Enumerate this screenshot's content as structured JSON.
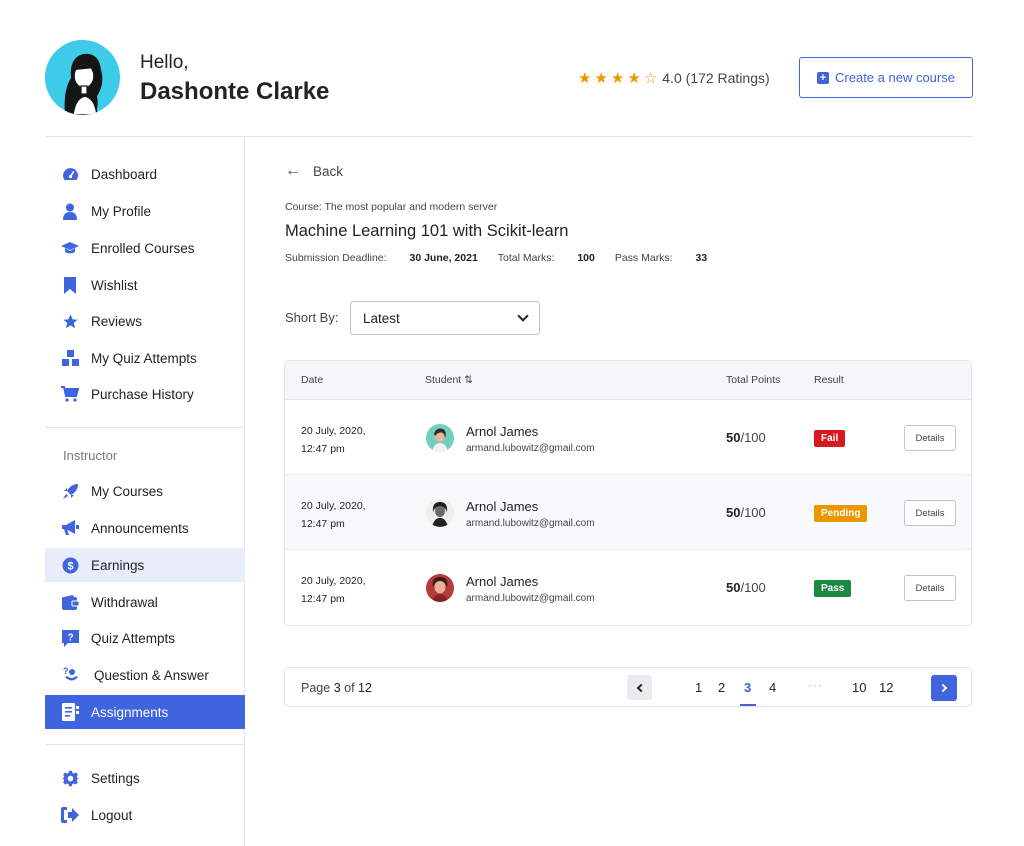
{
  "header": {
    "greeting": "Hello,",
    "user_name": "Dashonte Clarke",
    "rating_value": "4.0",
    "rating_text": "4.0 (172 Ratings)",
    "stars_filled": 4,
    "stars_total": 5,
    "create_button": "Create a new course"
  },
  "sidebar": {
    "items": [
      {
        "label": "Dashboard",
        "icon": "dashboard-icon"
      },
      {
        "label": "My Profile",
        "icon": "user-icon"
      },
      {
        "label": "Enrolled Courses",
        "icon": "graduation-cap-icon"
      },
      {
        "label": "Wishlist",
        "icon": "bookmark-icon"
      },
      {
        "label": "Reviews",
        "icon": "star-icon"
      },
      {
        "label": "My Quiz Attempts",
        "icon": "quiz-blocks-icon"
      },
      {
        "label": "Purchase History",
        "icon": "cart-icon"
      }
    ],
    "instructor_heading": "Instructor",
    "instructor_items": [
      {
        "label": "My Courses",
        "icon": "rocket-icon"
      },
      {
        "label": "Announcements",
        "icon": "megaphone-icon"
      },
      {
        "label": "Earnings",
        "icon": "dollar-coin-icon"
      },
      {
        "label": "Withdrawal",
        "icon": "wallet-icon"
      },
      {
        "label": "Quiz Attempts",
        "icon": "question-box-icon"
      },
      {
        "label": "Question & Answer",
        "icon": "question-answer-icon"
      },
      {
        "label": "Assignments",
        "icon": "assignment-icon"
      }
    ],
    "bottom_items": [
      {
        "label": "Settings",
        "icon": "gear-icon"
      },
      {
        "label": "Logout",
        "icon": "logout-icon"
      }
    ],
    "active": "Assignments",
    "highlighted": "Earnings"
  },
  "main": {
    "back_label": "Back",
    "course_label": "Course: The most popular and modern server",
    "course_title": "Machine Learning 101 with Scikit-learn",
    "deadline_label": "Submission Deadline:",
    "deadline_value": "30 June, 2021",
    "total_marks_label": "Total Marks:",
    "total_marks_value": "100",
    "pass_marks_label": "Pass Marks:",
    "pass_marks_value": "33",
    "sort_label": "Short By:",
    "sort_value": "Latest"
  },
  "table": {
    "headers": {
      "date": "Date",
      "student": "Student",
      "sort_icon": "⇅",
      "total_points": "Total Points",
      "result": "Result"
    },
    "rows": [
      {
        "date_line1": "20 July, 2020,",
        "date_line2": "12:47 pm",
        "name": "Arnol James",
        "email": "armand.lubowitz@gmail.com",
        "points": "50",
        "points_total": "/100",
        "result": "Fail",
        "action": "Details"
      },
      {
        "date_line1": "20 July, 2020,",
        "date_line2": "12:47 pm",
        "name": "Arnol James",
        "email": "armand.lubowitz@gmail.com",
        "points": "50",
        "points_total": "/100",
        "result": "Pending",
        "action": "Details"
      },
      {
        "date_line1": "20 July, 2020,",
        "date_line2": "12:47 pm",
        "name": "Arnol James",
        "email": "armand.lubowitz@gmail.com",
        "points": "50",
        "points_total": "/100",
        "result": "Pass",
        "action": "Details"
      }
    ]
  },
  "pagination": {
    "page_word": "Page",
    "current": "3",
    "of_word": "of",
    "total": "12",
    "pages": [
      "1",
      "2",
      "3",
      "4",
      "10",
      "12"
    ],
    "dots": "···"
  },
  "colors": {
    "primary": "#3e64de",
    "fail": "#d61a1f",
    "pending": "#ed9700",
    "pass": "#1c8a3e",
    "star": "#ed9700"
  }
}
